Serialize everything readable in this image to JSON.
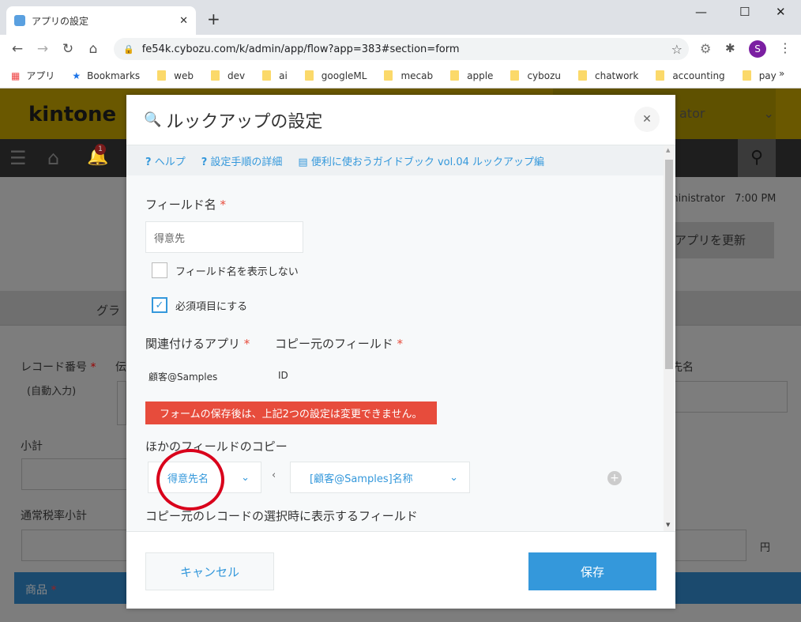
{
  "browser": {
    "tab_title": "アプリの設定",
    "url": "fe54k.cybozu.com/k/admin/app/flow?app=383#section=form",
    "profile_initial": "S",
    "bookmarks": [
      "アプリ",
      "Bookmarks",
      "web",
      "dev",
      "ai",
      "googleML",
      "mecab",
      "apple",
      "cybozu",
      "chatwork",
      "accounting",
      "pay"
    ]
  },
  "kintone": {
    "logo": "kintone",
    "user_fragment": "ator",
    "notif_count": "1",
    "admin_fragment": "ministrator",
    "time": "7:00 PM",
    "update_button": "アプリを更新",
    "tab_fragment": "グラ",
    "fields": {
      "record_no": "レコード番号",
      "auto": "(自動入力)",
      "den": "伝",
      "subtotal": "小計",
      "normal_tax_subtotal": "通常税率小計",
      "product": "商品",
      "customer_name_fragment": "先名",
      "yen": "円"
    }
  },
  "modal": {
    "title": "ルックアップの設定",
    "links": [
      "ヘルプ",
      "設定手順の詳細",
      "便利に使おうガイドブック vol.04 ルックアップ編"
    ],
    "field_name_label": "フィールド名",
    "field_name_value": "得意先",
    "hide_label": "フィールド名を表示しない",
    "hide_checked": false,
    "required_label": "必須項目にする",
    "required_checked": true,
    "related_app_label": "関連付けるアプリ",
    "source_field_label": "コピー元のフィールド",
    "related_app_value": "顧客@Samples",
    "source_field_value": "ID",
    "warning": "フォームの保存後は、上記2つの設定は変更できません。",
    "copy_label": "ほかのフィールドのコピー",
    "copy_dest": "得意先名",
    "copy_src": "[顧客@Samples]名称",
    "display_label": "コピー元のレコードの選択時に表示するフィールド",
    "cancel": "キャンセル",
    "save": "保存"
  },
  "colors": {
    "accent": "#3498db",
    "warning": "#e74c3c",
    "annotation": "#d9001b"
  }
}
